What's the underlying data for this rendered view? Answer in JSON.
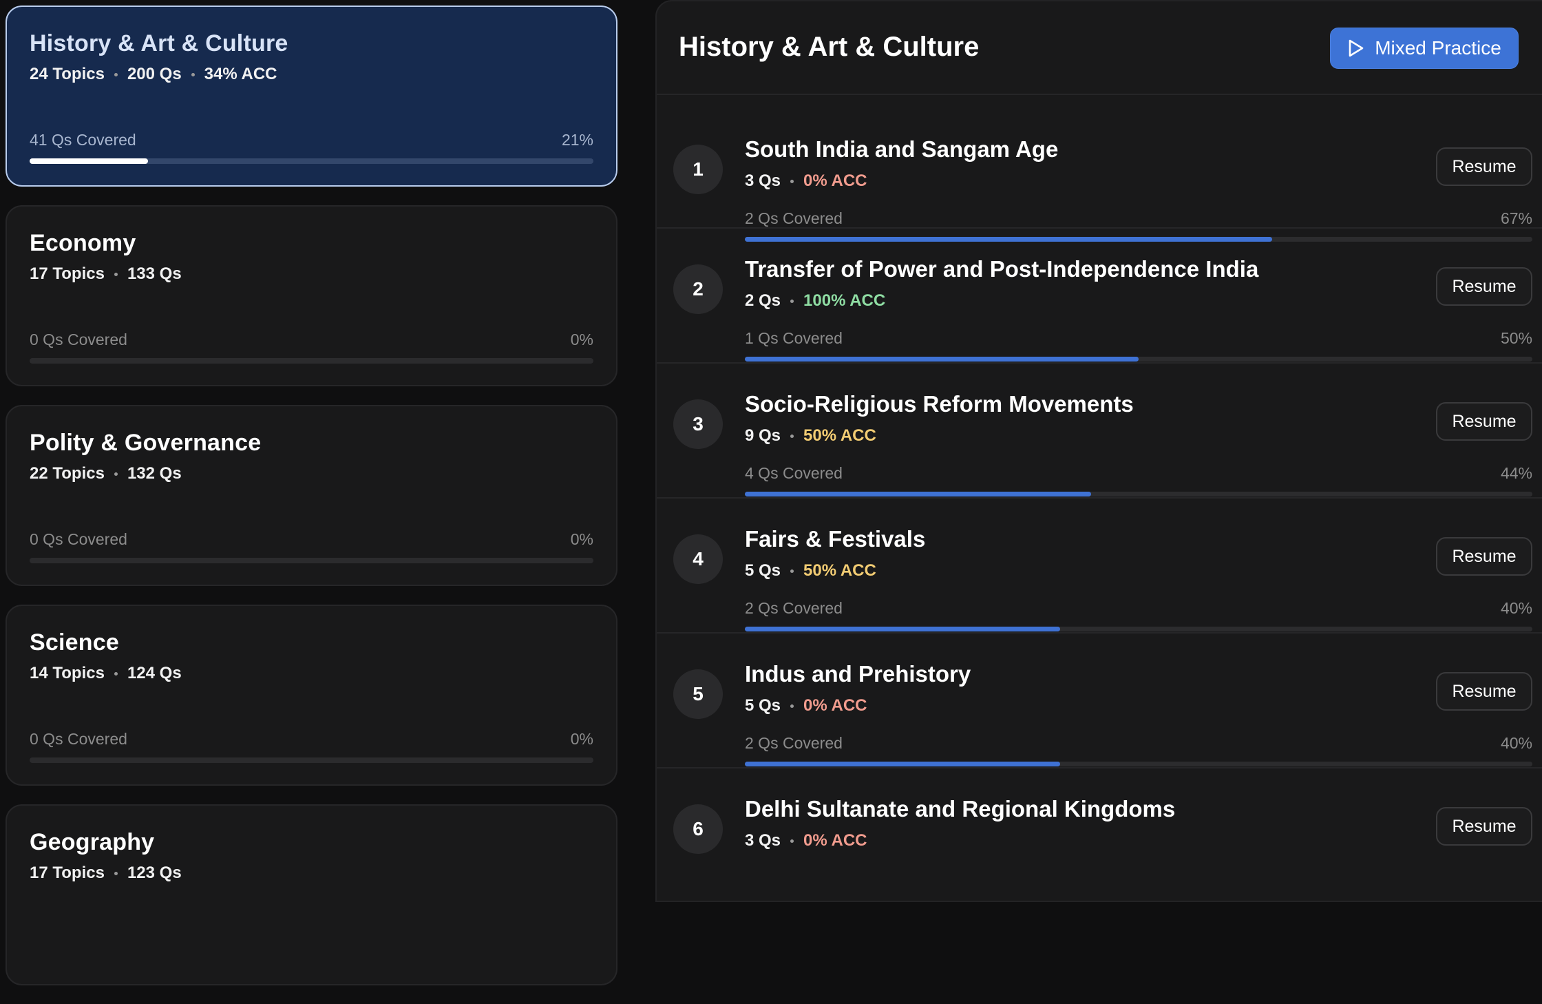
{
  "subjects": [
    {
      "name": "History & Art & Culture",
      "topics": "24 Topics",
      "qs": "200 Qs",
      "acc": "34% ACC",
      "covered": "41 Qs Covered",
      "percent": "21%",
      "progress": 0.21,
      "active": true
    },
    {
      "name": "Economy",
      "topics": "17 Topics",
      "qs": "133 Qs",
      "covered": "0 Qs Covered",
      "percent": "0%",
      "progress": 0
    },
    {
      "name": "Polity & Governance",
      "topics": "22 Topics",
      "qs": "132 Qs",
      "covered": "0 Qs Covered",
      "percent": "0%",
      "progress": 0
    },
    {
      "name": "Science",
      "topics": "14 Topics",
      "qs": "124 Qs",
      "covered": "0 Qs Covered",
      "percent": "0%",
      "progress": 0
    },
    {
      "name": "Geography",
      "topics": "17 Topics",
      "qs": "123 Qs"
    }
  ],
  "panel": {
    "title": "History & Art & Culture",
    "mixed_practice_label": "Mixed Practice",
    "play_icon": "play-icon",
    "accent_color": "#3d73d6"
  },
  "topics": [
    {
      "num": "1",
      "title": "South India and Sangam Age",
      "qs": "3 Qs",
      "acc": "0% ACC",
      "acc_color": "red",
      "covered": "2 Qs Covered",
      "percent": "67%",
      "progress": 0.67,
      "action": "Resume"
    },
    {
      "num": "2",
      "title": "Transfer of Power and Post-Independence India",
      "qs": "2 Qs",
      "acc": "100% ACC",
      "acc_color": "green",
      "covered": "1 Qs Covered",
      "percent": "50%",
      "progress": 0.5,
      "action": "Resume"
    },
    {
      "num": "3",
      "title": "Socio-Religious Reform Movements",
      "qs": "9 Qs",
      "acc": "50% ACC",
      "acc_color": "yellow",
      "covered": "4 Qs Covered",
      "percent": "44%",
      "progress": 0.44,
      "action": "Resume"
    },
    {
      "num": "4",
      "title": "Fairs & Festivals",
      "qs": "5 Qs",
      "acc": "50% ACC",
      "acc_color": "yellow",
      "covered": "2 Qs Covered",
      "percent": "40%",
      "progress": 0.4,
      "action": "Resume"
    },
    {
      "num": "5",
      "title": "Indus and Prehistory",
      "qs": "5 Qs",
      "acc": "0% ACC",
      "acc_color": "red",
      "covered": "2 Qs Covered",
      "percent": "40%",
      "progress": 0.4,
      "action": "Resume"
    },
    {
      "num": "6",
      "title": "Delhi Sultanate and Regional Kingdoms",
      "qs": "3 Qs",
      "acc": "0% ACC",
      "acc_color": "red",
      "action": "Resume"
    }
  ]
}
